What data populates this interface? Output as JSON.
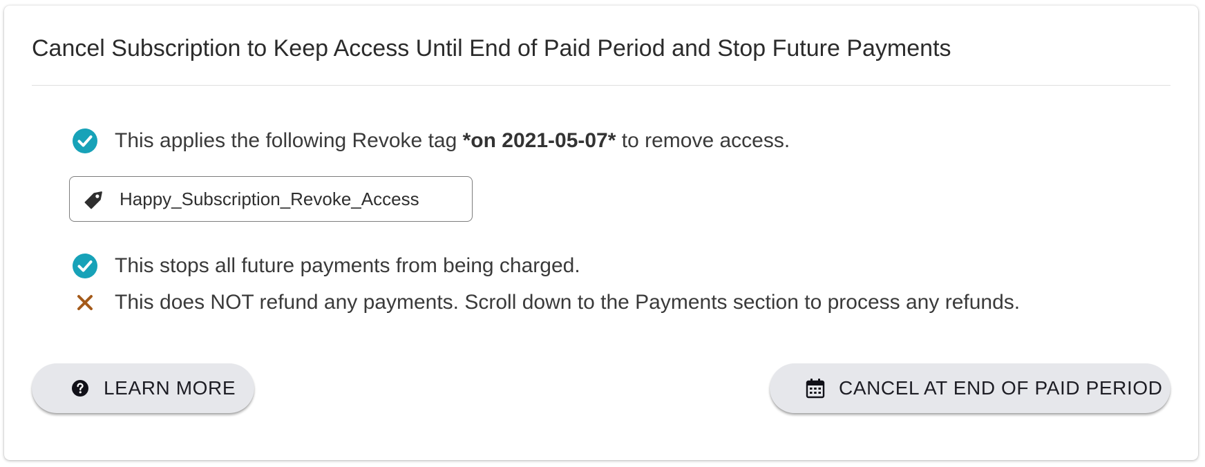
{
  "card": {
    "title": "Cancel Subscription to Keep Access Until End of Paid Period and Stop Future Payments"
  },
  "info": {
    "revoke": {
      "prefix": "This applies the following Revoke tag ",
      "date_emphasis": "*on 2021-05-07*",
      "suffix": " to remove access.",
      "icon": "check-circle-icon"
    },
    "tag": {
      "label": "Happy_Subscription_Revoke_Access",
      "icon": "tag-icon"
    },
    "stops_payments": {
      "text": "This stops all future payments from being charged.",
      "icon": "check-circle-icon"
    },
    "no_refund": {
      "text": "This does NOT refund any payments. Scroll down to the Payments section to process any refunds.",
      "icon": "x-mark-icon"
    }
  },
  "buttons": {
    "learn_more": {
      "label": "LEARN MORE",
      "icon": "question-circle-icon"
    },
    "cancel_end_period": {
      "label": "CANCEL AT END OF PAID PERIOD",
      "icon": "calendar-icon"
    }
  },
  "colors": {
    "check": "#17a2b8",
    "x_mark": "#a45a1a",
    "button_bg": "#e6e7eb"
  }
}
